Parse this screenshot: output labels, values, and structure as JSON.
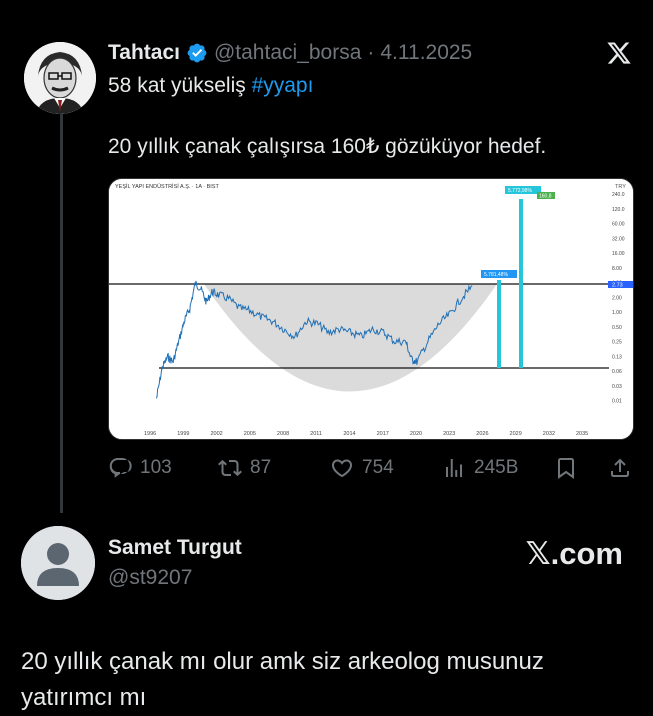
{
  "tweet": {
    "display_name": "Tahtacı",
    "handle": "@tahtaci_borsa",
    "separator": "·",
    "date": "4.11.2025",
    "text_line1_prefix": "58 kat yükseliş ",
    "hashtag": "#yyapı",
    "text_line2": "20 yıllık çanak çalışırsa 160₺ gözüküyor hedef.",
    "stats": {
      "replies": "103",
      "reposts": "87",
      "likes": "754",
      "views": "245B"
    }
  },
  "chart_data": {
    "type": "line",
    "title": "YEŞİL YAPI ENDÜSTRİSİ A.Ş. · 1A · BIST",
    "currency": "TRY",
    "y_scale": "log",
    "x_tick_labels": [
      "1996",
      "1999",
      "2002",
      "2005",
      "2008",
      "2011",
      "2014",
      "2017",
      "2020",
      "2023",
      "2026",
      "2029",
      "2032",
      "2035"
    ],
    "y_tick_labels": [
      "240.0",
      "120.0",
      "60.00",
      "32.00",
      "16.00",
      "8.00",
      "4.00",
      "2.00",
      "1.00",
      "0.50",
      "0.25",
      "0.13",
      "0.06",
      "0.03",
      "0.01"
    ],
    "resistance_label": "2.73",
    "support_level": 0.06,
    "annotations": [
      {
        "label": "5.781,48%",
        "color": "#2196f3"
      },
      {
        "label": "5.772,98%",
        "color": "#26c6da"
      },
      {
        "label": "160,8",
        "color": "#4caf50"
      }
    ],
    "series": [
      {
        "x": [
          1996.5,
          1997,
          1997.5,
          1998,
          1998.5,
          1999,
          1999.5,
          2000,
          2000.5,
          2001,
          2001.5,
          2002,
          2003,
          2004,
          2005,
          2006,
          2007,
          2008,
          2009,
          2010,
          2011,
          2012,
          2013,
          2014,
          2015,
          2016,
          2017,
          2018,
          2019,
          2019.5,
          2020,
          2021,
          2022,
          2023,
          2024,
          2025
        ],
        "y": [
          0.015,
          0.06,
          0.1,
          0.08,
          0.2,
          0.5,
          0.9,
          2.8,
          2.2,
          1.2,
          1.9,
          1.7,
          1.4,
          0.9,
          0.8,
          0.6,
          0.5,
          0.35,
          0.25,
          0.5,
          0.45,
          0.3,
          0.35,
          0.3,
          0.25,
          0.35,
          0.3,
          0.2,
          0.2,
          0.09,
          0.08,
          0.2,
          0.45,
          0.7,
          1.4,
          2.5
        ]
      }
    ]
  },
  "reply": {
    "display_name": "Samet Turgut",
    "handle": "@st9207",
    "watermark": "𝕏.com",
    "text": "20 yıllık çanak mı olur amk siz arkeolog musunuz yatırımcı mı"
  }
}
